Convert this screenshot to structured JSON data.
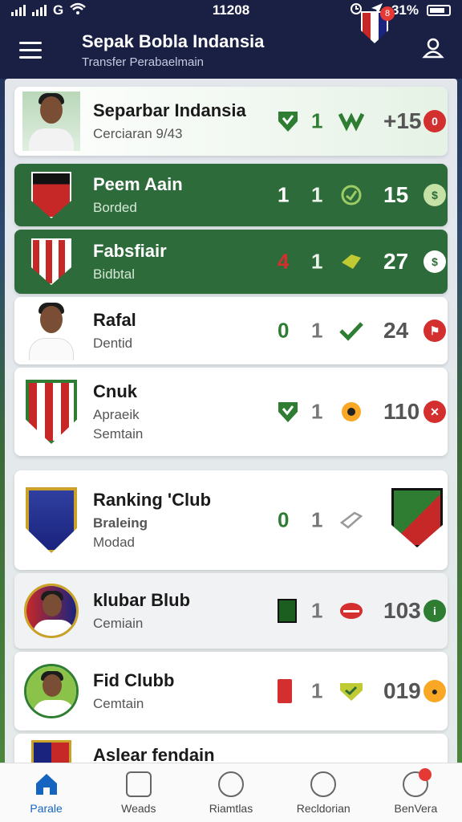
{
  "status_bar": {
    "time": "11208",
    "battery": "31%"
  },
  "header": {
    "title": "Sepak Bobla Indansia",
    "subtitle": "Transfer Perabaelmain",
    "badge_count": "8"
  },
  "rows": [
    {
      "name": "Separbar Indansia",
      "line2": "Cerciaran 9/43",
      "line3": "",
      "stat_a": "",
      "stat_b": "1",
      "score": "15",
      "prefix": "+"
    },
    {
      "name": "Peem Aain",
      "line2": "Borded",
      "line3": "",
      "stat_a": "1",
      "stat_b": "1",
      "score": "15",
      "badge": "$"
    },
    {
      "name": "Fabsfiair",
      "line2": "Bidbtal",
      "line3": "",
      "stat_a": "4",
      "stat_b": "1",
      "score": "27",
      "badge": "$"
    },
    {
      "name": "Rafal",
      "line2": "Dentid",
      "line3": "",
      "stat_a": "0",
      "stat_b": "1",
      "score": "24"
    },
    {
      "name": "Cnuk",
      "line2": "Apraeik",
      "line3": "Semtain",
      "stat_a": "",
      "stat_b": "1",
      "score": "110"
    },
    {
      "name": "Ranking 'Club",
      "line2": "Braleing",
      "line3": "Modad",
      "stat_a": "0",
      "stat_b": "1",
      "score": ""
    },
    {
      "name": "klubar Blub",
      "line2": "Cemiain",
      "line3": "",
      "stat_a": "",
      "stat_b": "1",
      "score": "103"
    },
    {
      "name": "Fid Clubb",
      "line2": "Cemtain",
      "line3": "",
      "stat_a": "",
      "stat_b": "1",
      "score": "019"
    },
    {
      "name": "Aslear fendain",
      "line2": "",
      "line3": "",
      "stat_a": "",
      "stat_b": "",
      "score": ""
    }
  ],
  "bottom_nav": [
    {
      "label": "Parale",
      "icon": "home-icon",
      "active": true
    },
    {
      "label": "Weads",
      "icon": "camera-icon",
      "active": false
    },
    {
      "label": "Riamtlas",
      "icon": "ball-icon",
      "active": false
    },
    {
      "label": "Recldorian",
      "icon": "edit-icon",
      "active": false
    },
    {
      "label": "BenVera",
      "icon": "profile-icon",
      "active": false
    }
  ],
  "colors": {
    "header_bg": "#1a1f44",
    "row_green": "#2e6b3a",
    "accent_red": "#d32f2f",
    "active_nav": "#1565c0"
  }
}
